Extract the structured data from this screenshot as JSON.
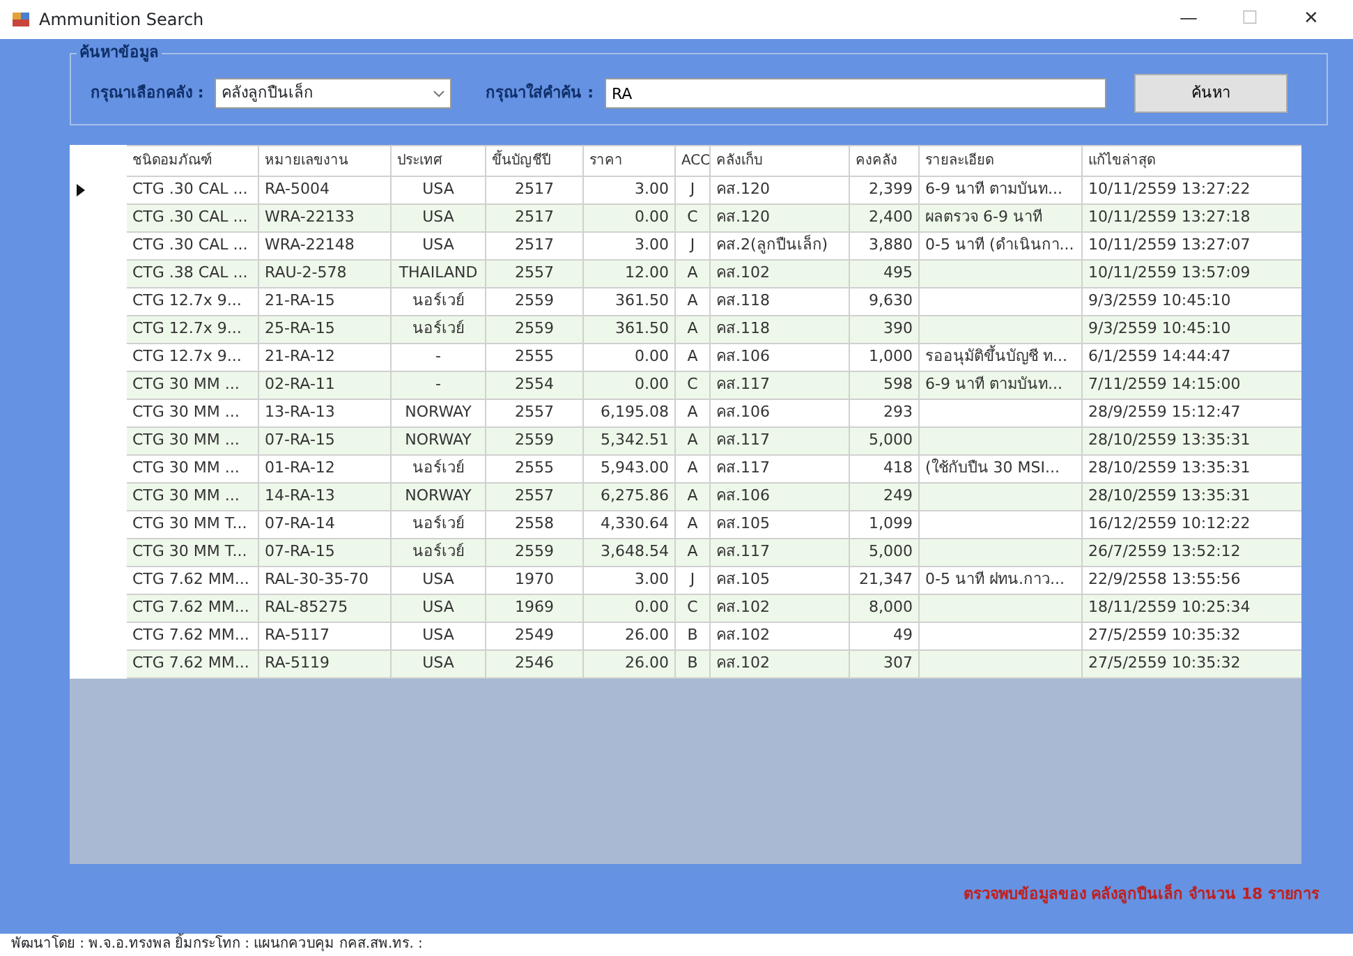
{
  "window": {
    "title": "Ammunition Search",
    "controls": [
      "—",
      "☐",
      "✕"
    ]
  },
  "search": {
    "group_title": "ค้นหาข้อมูล",
    "warehouse_label": "กรุณาเลือกคลัง :",
    "warehouse_value": "คลังลูกปืนเล็ก",
    "keyword_label": "กรุณาใส่คำค้น :",
    "keyword_value": "RA",
    "button": "ค้นหา"
  },
  "table": {
    "columns": [
      "ชนิดอมภัณฑ์",
      "หมายเลขงาน",
      "ประเทศ",
      "ขึ้นบัญชีปี",
      "ราคา",
      "ACC",
      "คลังเก็บ",
      "คงคลัง",
      "รายละเอียด",
      "แก้ไขล่าสุด"
    ],
    "rows": [
      {
        "selected": true,
        "cells": [
          "CTG .30 CAL ...",
          "RA-5004",
          "USA",
          "2517",
          "3.00",
          "J",
          "คส.120",
          "2,399",
          "6-9 นาที ตามบันท...",
          "10/11/2559 13:27:22"
        ]
      },
      {
        "selected": false,
        "cells": [
          "CTG .30 CAL ...",
          "WRA-22133",
          "USA",
          "2517",
          "0.00",
          "C",
          "คส.120",
          "2,400",
          "ผลตรวจ 6-9 นาที",
          "10/11/2559 13:27:18"
        ]
      },
      {
        "selected": false,
        "cells": [
          "CTG .30 CAL ...",
          "WRA-22148",
          "USA",
          "2517",
          "3.00",
          "J",
          "คส.2(ลูกปืนเล็ก)",
          "3,880",
          "0-5 นาที (ดำเนินกา...",
          "10/11/2559 13:27:07"
        ]
      },
      {
        "selected": false,
        "cells": [
          "CTG .38 CAL ...",
          "RAU-2-578",
          "THAILAND",
          "2557",
          "12.00",
          "A",
          "คส.102",
          "495",
          "",
          "10/11/2559 13:57:09"
        ]
      },
      {
        "selected": false,
        "cells": [
          "CTG 12.7x 9...",
          "21-RA-15",
          "นอร์เวย์",
          "2559",
          "361.50",
          "A",
          "คส.118",
          "9,630",
          "",
          "9/3/2559 10:45:10"
        ]
      },
      {
        "selected": false,
        "cells": [
          "CTG 12.7x 9...",
          "25-RA-15",
          "นอร์เวย์",
          "2559",
          "361.50",
          "A",
          "คส.118",
          "390",
          "",
          "9/3/2559 10:45:10"
        ]
      },
      {
        "selected": false,
        "cells": [
          "CTG 12.7x 9...",
          "21-RA-12",
          "-",
          "2555",
          "0.00",
          "A",
          "คส.106",
          "1,000",
          "รออนุมัติขึ้นบัญชี ท...",
          "6/1/2559 14:44:47"
        ]
      },
      {
        "selected": false,
        "cells": [
          "CTG 30 MM ...",
          "02-RA-11",
          "-",
          "2554",
          "0.00",
          "C",
          "คส.117",
          "598",
          "6-9 นาที ตามบันท...",
          "7/11/2559 14:15:00"
        ]
      },
      {
        "selected": false,
        "cells": [
          "CTG 30 MM ...",
          "13-RA-13",
          "NORWAY",
          "2557",
          "6,195.08",
          "A",
          "คส.106",
          "293",
          "",
          "28/9/2559 15:12:47"
        ]
      },
      {
        "selected": false,
        "cells": [
          "CTG 30 MM ...",
          "07-RA-15",
          "NORWAY",
          "2559",
          "5,342.51",
          "A",
          "คส.117",
          "5,000",
          "",
          "28/10/2559 13:35:31"
        ]
      },
      {
        "selected": false,
        "cells": [
          "CTG 30 MM ...",
          "01-RA-12",
          "นอร์เวย์",
          "2555",
          "5,943.00",
          "A",
          "คส.117",
          "418",
          "(ใช้กับปืน 30 MSI...",
          "28/10/2559 13:35:31"
        ]
      },
      {
        "selected": false,
        "cells": [
          "CTG 30 MM ...",
          "14-RA-13",
          "NORWAY",
          "2557",
          "6,275.86",
          "A",
          "คส.106",
          "249",
          "",
          "28/10/2559 13:35:31"
        ]
      },
      {
        "selected": false,
        "cells": [
          "CTG 30 MM T...",
          "07-RA-14",
          "นอร์เวย์",
          "2558",
          "4,330.64",
          "A",
          "คส.105",
          "1,099",
          "",
          "16/12/2559 10:12:22"
        ]
      },
      {
        "selected": false,
        "cells": [
          "CTG 30 MM T...",
          "07-RA-15",
          "นอร์เวย์",
          "2559",
          "3,648.54",
          "A",
          "คส.117",
          "5,000",
          "",
          "26/7/2559 13:52:12"
        ]
      },
      {
        "selected": false,
        "cells": [
          "CTG 7.62 MM...",
          "RAL-30-35-70",
          "USA",
          "1970",
          "3.00",
          "J",
          "คส.105",
          "21,347",
          "0-5 นาที ฝทน.กาว...",
          "22/9/2558 13:55:56"
        ]
      },
      {
        "selected": false,
        "cells": [
          "CTG 7.62 MM...",
          "RAL-85275",
          "USA",
          "1969",
          "0.00",
          "C",
          "คส.102",
          "8,000",
          "",
          "18/11/2559 10:25:34"
        ]
      },
      {
        "selected": false,
        "cells": [
          "CTG 7.62 MM...",
          "RA-5117",
          "USA",
          "2549",
          "26.00",
          "B",
          "คส.102",
          "49",
          "",
          "27/5/2559 10:35:32"
        ]
      },
      {
        "selected": false,
        "cells": [
          "CTG 7.62 MM...",
          "RA-5119",
          "USA",
          "2546",
          "26.00",
          "B",
          "คส.102",
          "307",
          "",
          "27/5/2559 10:35:32"
        ]
      }
    ]
  },
  "result_text": "ตรวจพบข้อมูลของ คลังลูกปืนเล็ก จำนวน 18 รายการ",
  "status_bar": "พัฒนาโดย : พ.จ.อ.ทรงพล  ยิ้มกระโทก : แผนกควบคุม กคส.สพ.ทร. :"
}
